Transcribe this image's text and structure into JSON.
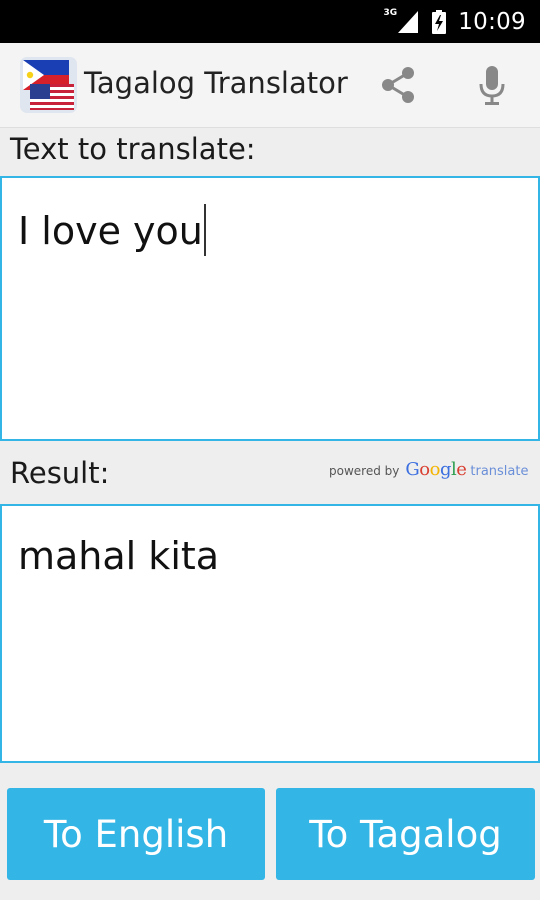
{
  "status_bar": {
    "network_type": "3G",
    "time": "10:09"
  },
  "action_bar": {
    "title": "Tagalog Translator",
    "icons": [
      "app-flag-icon",
      "share-icon",
      "microphone-icon"
    ]
  },
  "input": {
    "label": "Text to translate:",
    "value": "I love you"
  },
  "result": {
    "label": "Result:",
    "value": "mahal kita",
    "attribution": {
      "powered_by": "powered by",
      "google": "Google",
      "translate": "translate"
    }
  },
  "buttons": {
    "to_english": "To English",
    "to_tagalog": "To Tagalog"
  },
  "colors": {
    "accent": "#33b5e5",
    "status_bar": "#000000",
    "action_bar": "#f4f4f4",
    "background": "#eeeeee"
  }
}
